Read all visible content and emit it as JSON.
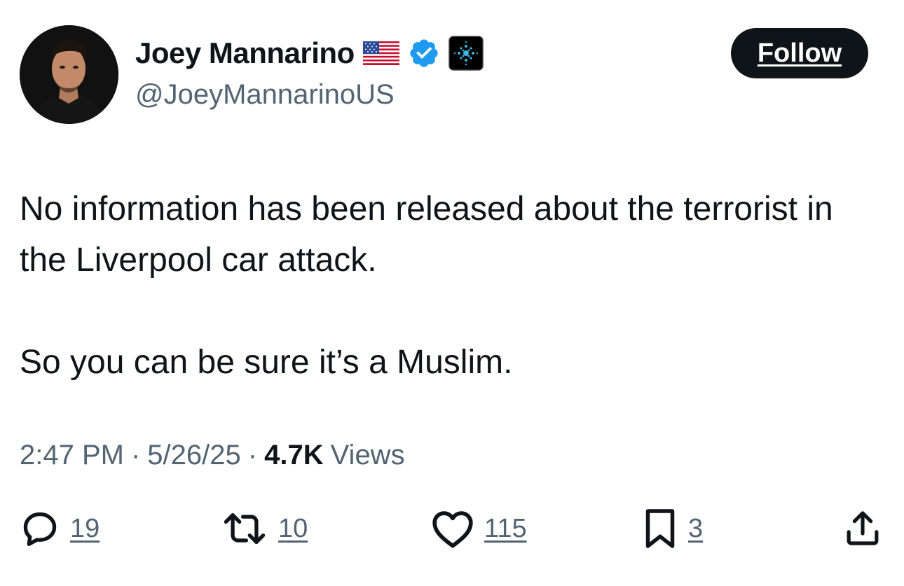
{
  "author": {
    "display_name": "Joey Mannarino",
    "handle": "@JoeyMannarinoUS",
    "badges": [
      "us-flag-icon",
      "verified-badge-icon",
      "affiliate-badge-icon"
    ]
  },
  "follow_label": "Follow",
  "tweet": {
    "lines": [
      "No information has been released about the terrorist in the Liverpool car attack.",
      "So you can be sure it’s a Muslim."
    ]
  },
  "meta": {
    "time": "2:47 PM",
    "separator": "·",
    "date": "5/26/25",
    "views_count": "4.7K",
    "views_label": "Views"
  },
  "actions": {
    "replies": "19",
    "reposts": "10",
    "likes": "115",
    "bookmarks": "3"
  },
  "colors": {
    "text": "#0f1419",
    "secondary": "#536471",
    "verified": "#1d9bf0",
    "button": "#0f1419"
  }
}
